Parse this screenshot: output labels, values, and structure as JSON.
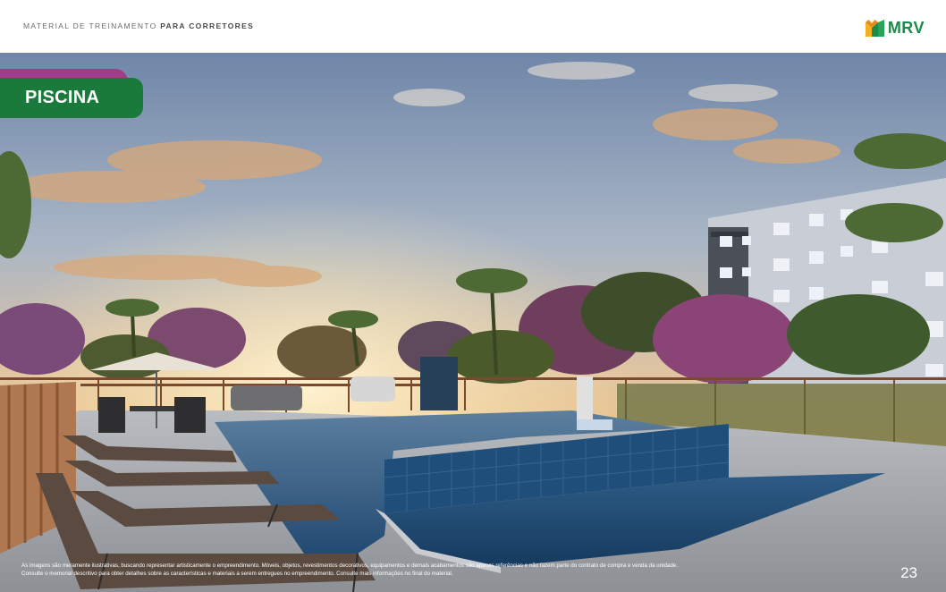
{
  "header": {
    "title_prefix": "MATERIAL DE TREINAMENTO ",
    "title_bold": "PARA CORRETORES",
    "logo_text": "MRV",
    "logo_icon": "mrv-logo-icon"
  },
  "section_tag": {
    "label": "PISCINA"
  },
  "footer": {
    "disclaimer_line1": "As imagens são meramente ilustrativas, buscando representar artisticamente o empreendimento. Móveis, objetos, revestimentos decorativos, equipamentos e demais acabamentos são apenas referências e não fazem parte do contrato de compra e venda da unidade.",
    "disclaimer_line2": "Consulte o memorial descritivo para obter detalhes sobre as características e materiais a serem entregues no empreendimento. Consulte mais informações no final do material.",
    "page_number": "23"
  },
  "colors": {
    "brand_green": "#1a7a3c",
    "brand_magenta": "#a33a8a",
    "logo_yellow": "#f2b01e"
  }
}
